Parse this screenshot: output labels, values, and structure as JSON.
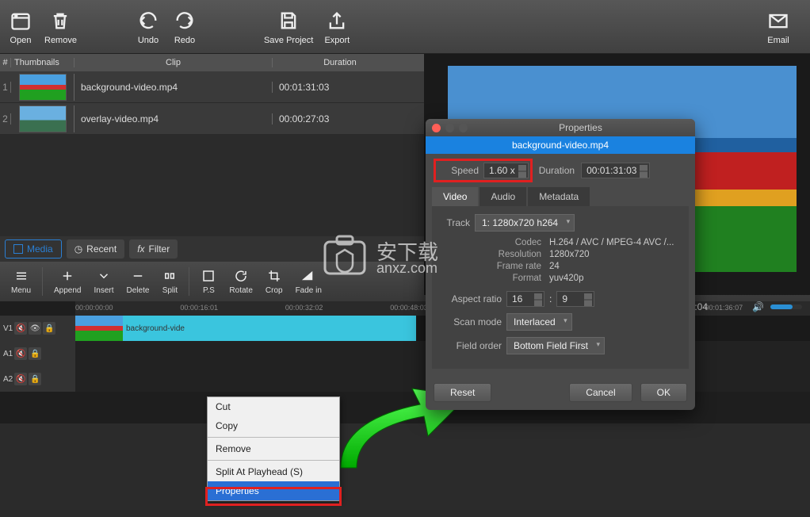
{
  "toolbar": {
    "open": "Open",
    "remove": "Remove",
    "undo": "Undo",
    "redo": "Redo",
    "save_project": "Save Project",
    "export": "Export",
    "email": "Email"
  },
  "clip_table": {
    "headers": {
      "num": "#",
      "thumb": "Thumbnails",
      "clip": "Clip",
      "duration": "Duration"
    },
    "rows": [
      {
        "num": "1",
        "name": "background-video.mp4",
        "duration": "00:01:31:03"
      },
      {
        "num": "2",
        "name": "overlay-video.mp4",
        "duration": "00:00:27:03"
      }
    ]
  },
  "tabs": {
    "media": "Media",
    "recent": "Recent",
    "filter": "Filter"
  },
  "tl_toolbar": {
    "menu": "Menu",
    "append": "Append",
    "insert": "Insert",
    "delete": "Delete",
    "split": "Split",
    "ps": "P.S",
    "rotate": "Rotate",
    "crop": "Crop",
    "fade_in": "Fade in"
  },
  "ruler": [
    "00:00:00:00",
    "00:00:16:01",
    "00:00:32:02",
    "00:00:48:03",
    "",
    "",
    "00:01:36:07"
  ],
  "tracks": {
    "v1": "V1",
    "a1": "A1",
    "a2": "A2"
  },
  "timeline_clip_label": "background-vide",
  "context_menu": {
    "cut": "Cut",
    "copy": "Copy",
    "remove": "Remove",
    "split": "Split At Playhead (S)",
    "properties": "Properties"
  },
  "preview": {
    "timecode": "00:01:28:04"
  },
  "properties": {
    "window_title": "Properties",
    "file": "background-video.mp4",
    "speed_label": "Speed",
    "speed_value": "1.60 x",
    "duration_label": "Duration",
    "duration_value": "00:01:31:03",
    "tabs": {
      "video": "Video",
      "audio": "Audio",
      "metadata": "Metadata"
    },
    "track_label": "Track",
    "track_value": "1: 1280x720 h264",
    "info": {
      "codec_k": "Codec",
      "codec_v": "H.264 / AVC / MPEG-4 AVC /...",
      "resolution_k": "Resolution",
      "resolution_v": "1280x720",
      "framerate_k": "Frame rate",
      "framerate_v": "24",
      "format_k": "Format",
      "format_v": "yuv420p"
    },
    "aspect_label": "Aspect ratio",
    "aspect_w": "16",
    "aspect_sep": ":",
    "aspect_h": "9",
    "scan_label": "Scan mode",
    "scan_value": "Interlaced",
    "field_label": "Field order",
    "field_value": "Bottom Field First",
    "reset": "Reset",
    "cancel": "Cancel",
    "ok": "OK"
  },
  "watermark": {
    "line1": "安下载",
    "line2": "anxz.com"
  }
}
